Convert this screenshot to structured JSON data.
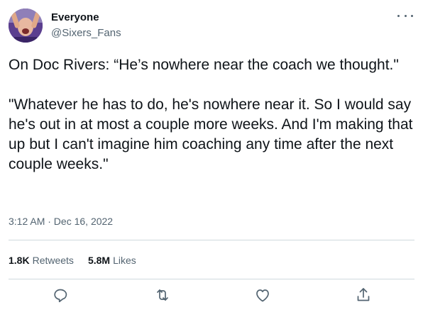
{
  "author": {
    "display_name": "Everyone",
    "handle": "@Sixers_Fans"
  },
  "tweet": {
    "text": "On Doc Rivers: “He’s nowhere near the coach we thought.\"\n\n\"Whatever he has to do, he's nowhere near it. So I would say he's out in at most a couple more weeks. And I'm making that up but I can't imagine him coaching any time after the next couple weeks.\"",
    "timestamp": "3:12 AM · Dec 16, 2022"
  },
  "stats": {
    "retweets_count": "1.8K",
    "retweets_label": "Retweets",
    "likes_count": "5.8M",
    "likes_label": "Likes"
  },
  "icons": {
    "reply": "reply-icon",
    "retweet": "retweet-icon",
    "like": "heart-icon",
    "share": "share-icon",
    "more": "more-icon"
  },
  "colors": {
    "text": "#0f1419",
    "secondary": "#536471",
    "divider": "#cfd9de"
  }
}
